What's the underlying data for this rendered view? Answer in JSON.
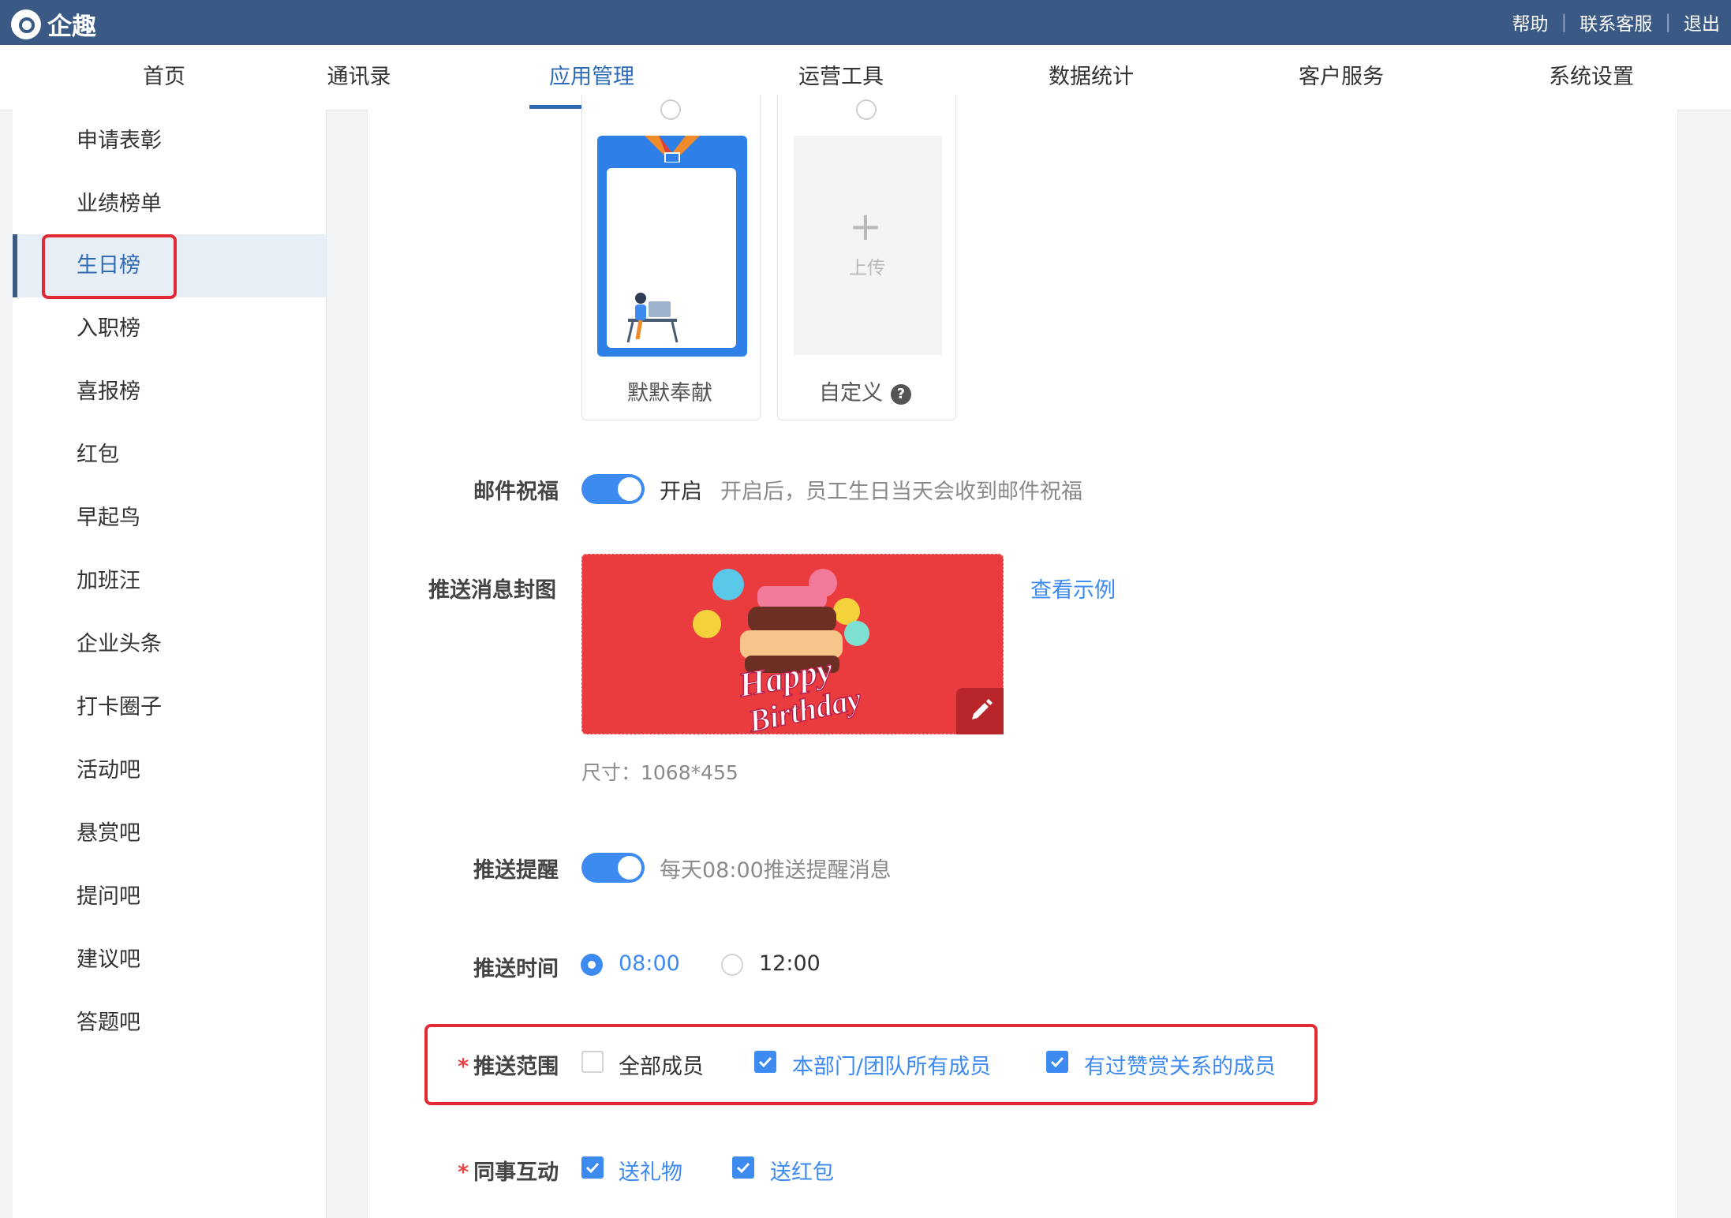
{
  "app": {
    "name": "企趣"
  },
  "top_links": [
    "帮助",
    "联系客服",
    "退出"
  ],
  "nav": {
    "items": [
      "首页",
      "通讯录",
      "应用管理",
      "运营工具",
      "数据统计",
      "客户服务",
      "系统设置"
    ],
    "active": "应用管理"
  },
  "sidebar": {
    "items": [
      "申请表彰",
      "业绩榜单",
      "生日榜",
      "入职榜",
      "喜报榜",
      "红包",
      "早起鸟",
      "加班汪",
      "企业头条",
      "打卡圈子",
      "活动吧",
      "悬赏吧",
      "提问吧",
      "建议吧",
      "答题吧"
    ],
    "active": "生日榜"
  },
  "templates": [
    {
      "label": "默默奉献"
    },
    {
      "label": "自定义",
      "upload_text": "上传",
      "upload_icon": "plus-icon"
    }
  ],
  "email": {
    "label": "邮件祝福",
    "state": "开启",
    "hint": "开启后，员工生日当天会收到邮件祝福",
    "enabled": true
  },
  "cover": {
    "label": "推送消息封图",
    "view_example": "查看示例",
    "size_text": "尺寸：1068*455",
    "image_text_1": "Happy",
    "image_text_2": "Birthday"
  },
  "remind": {
    "label": "推送提醒",
    "hint": "每天08:00推送提醒消息",
    "enabled": true
  },
  "push_time": {
    "label": "推送时间",
    "options": [
      "08:00",
      "12:00"
    ],
    "selected": "08:00"
  },
  "push_scope": {
    "label": "推送范围",
    "options": [
      {
        "label": "全部成员",
        "checked": false
      },
      {
        "label": "本部门/团队所有成员",
        "checked": true
      },
      {
        "label": "有过赞赏关系的成员",
        "checked": true
      }
    ]
  },
  "interaction": {
    "label": "同事互动",
    "options": [
      {
        "label": "送礼物",
        "checked": true
      },
      {
        "label": "送红包",
        "checked": true
      }
    ]
  },
  "colors": {
    "header": "#3a5a85",
    "accent": "#3d8af0",
    "highlight": "#e12a34"
  }
}
